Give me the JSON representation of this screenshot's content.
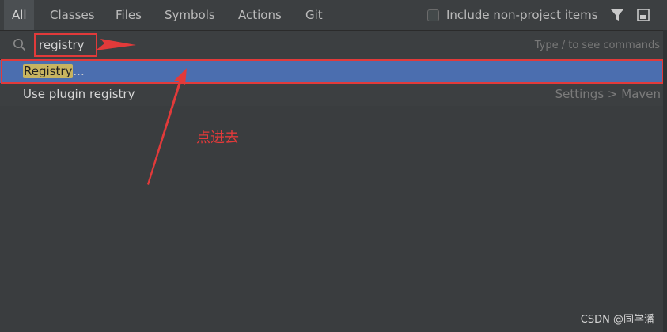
{
  "tabs": [
    {
      "label": "All",
      "active": true
    },
    {
      "label": "Classes"
    },
    {
      "label": "Files"
    },
    {
      "label": "Symbols"
    },
    {
      "label": "Actions"
    },
    {
      "label": "Git"
    }
  ],
  "include_option": {
    "label": "Include non-project items",
    "checked": false
  },
  "toolbar_icons": [
    "filter-icon",
    "preview-icon"
  ],
  "search": {
    "value": "registry",
    "hint": "Type / to see commands"
  },
  "results": [
    {
      "match": "Registry",
      "suffix": "...",
      "context": "",
      "selected": true
    },
    {
      "match": "",
      "label": "Use plugin registry",
      "context": "Settings > Maven",
      "selected": false
    }
  ],
  "annotation": "点进去",
  "watermark": "CSDN @同学潘",
  "colors": {
    "background": "#3c3f41",
    "selection": "#4b6eaf",
    "highlight": "#c8b460",
    "annotation_red": "#e23a3a"
  }
}
